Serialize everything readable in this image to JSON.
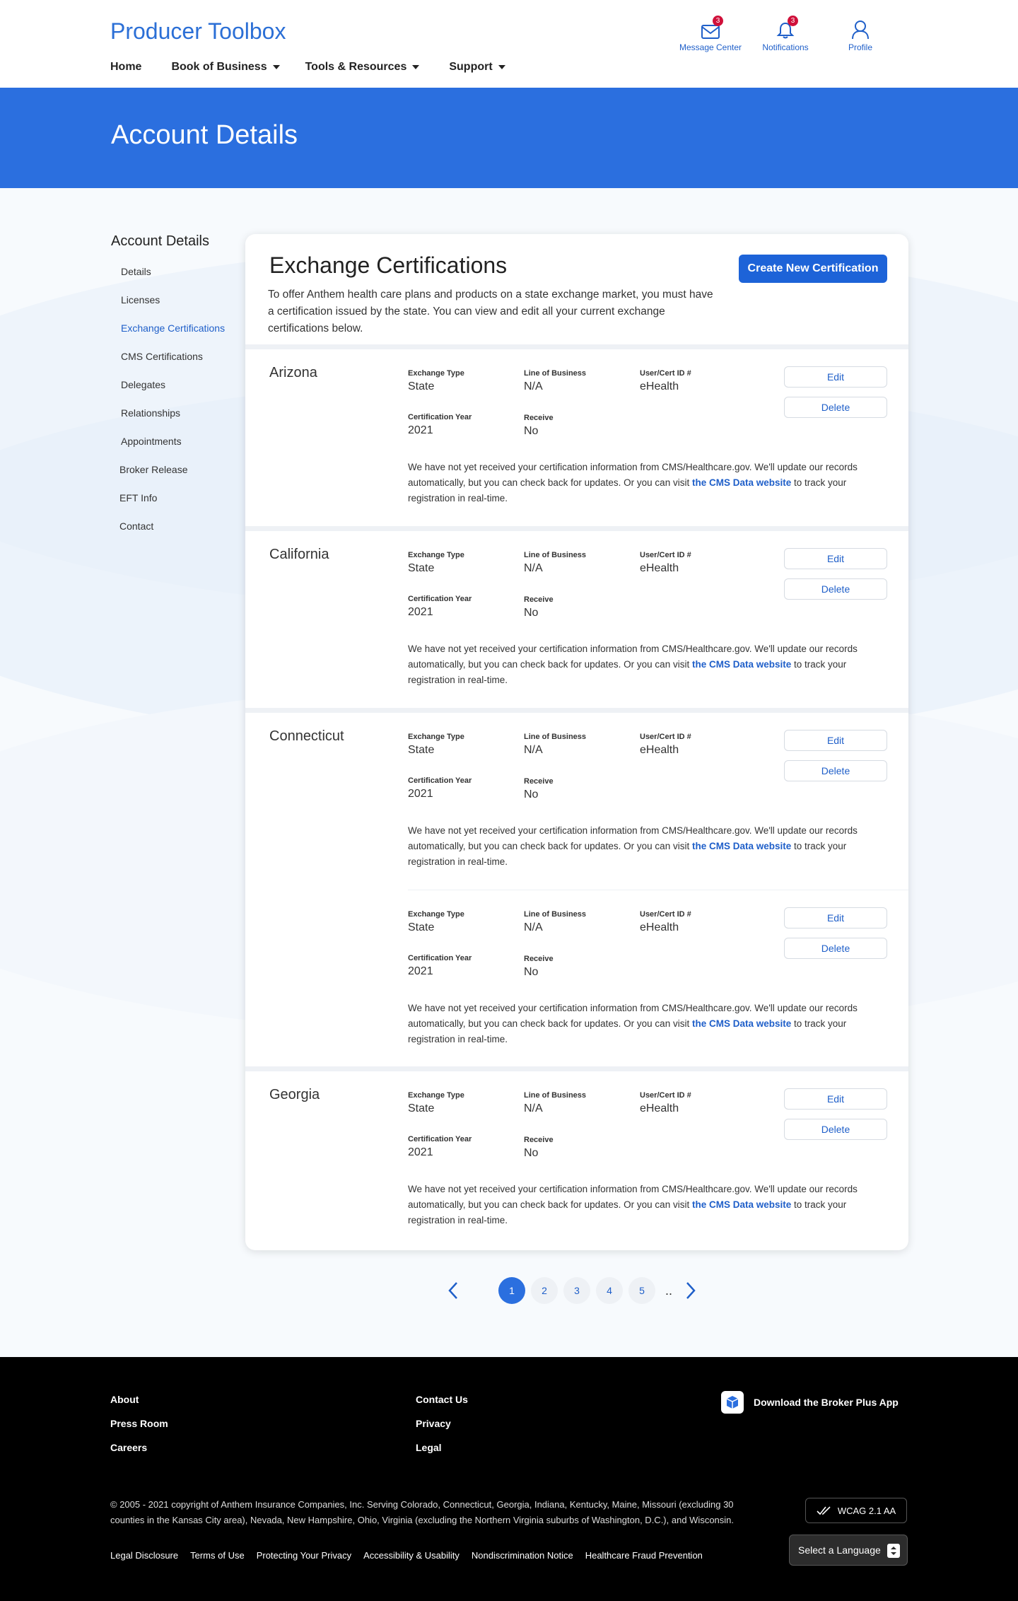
{
  "header": {
    "brand": "Producer Toolbox",
    "icons": {
      "messages": {
        "label": "Message Center",
        "badge": "3"
      },
      "notifications": {
        "label": "Notifications",
        "badge": "3"
      },
      "profile": {
        "label": "Profile"
      }
    },
    "nav": [
      "Home",
      "Book of Business",
      "Tools & Resources",
      "Support"
    ]
  },
  "banner": {
    "title": "Account Details"
  },
  "sidebar": {
    "title": "Account Details",
    "items": [
      "Details",
      "Licenses",
      "Exchange Certifications",
      "CMS Certifications",
      "Delegates",
      "Relationships",
      "Appointments",
      "Broker Release",
      "EFT Info",
      "Contact"
    ],
    "active_item": "Exchange Certifications"
  },
  "card": {
    "title": "Exchange Certifications",
    "description": "To offer Anthem health care plans and products on a state exchange market, you must have a certification issued by the state. You can view and edit all your current exchange certifications below.",
    "create_button": "Create New Certification"
  },
  "labels": {
    "exchange_type": "Exchange Type",
    "line_of_business": "Line of Business",
    "user_cert_id": "User/Cert ID #",
    "certification_year": "Certification Year",
    "receive": "Receive",
    "edit": "Edit",
    "delete": "Delete",
    "msg_before": "We have not yet received your certification information from CMS/Healthcare.gov. We'll update our records automatically, but you can check back for updates. Or you can visit ",
    "msg_link": "the CMS Data website",
    "msg_after": " to track your registration in real-time."
  },
  "states": [
    {
      "name": "Arizona",
      "certs": [
        {
          "exchange_type": "State",
          "line_of_business": "N/A",
          "user_cert_id": "eHealth",
          "certification_year": "2021",
          "receive": "No"
        }
      ]
    },
    {
      "name": "California",
      "certs": [
        {
          "exchange_type": "State",
          "line_of_business": "N/A",
          "user_cert_id": "eHealth",
          "certification_year": "2021",
          "receive": "No"
        }
      ]
    },
    {
      "name": "Connecticut",
      "certs": [
        {
          "exchange_type": "State",
          "line_of_business": "N/A",
          "user_cert_id": "eHealth",
          "certification_year": "2021",
          "receive": "No"
        },
        {
          "exchange_type": "State",
          "line_of_business": "N/A",
          "user_cert_id": "eHealth",
          "certification_year": "2021",
          "receive": "No"
        }
      ]
    },
    {
      "name": "Georgia",
      "certs": [
        {
          "exchange_type": "State",
          "line_of_business": "N/A",
          "user_cert_id": "eHealth",
          "certification_year": "2021",
          "receive": "No"
        }
      ]
    }
  ],
  "pagination": {
    "pages": [
      "1",
      "2",
      "3",
      "4",
      "5"
    ],
    "current": "1",
    "ellipsis": ".."
  },
  "footer": {
    "col1": [
      "About",
      "Press Room",
      "Careers"
    ],
    "col2": [
      "Contact Us",
      "Privacy",
      "Legal"
    ],
    "app": "Download the Broker Plus App",
    "copyright": "© 2005 - 2021 copyright of Anthem Insurance Companies, Inc. Serving Colorado, Connecticut, Georgia, Indiana, Kentucky, Maine, Missouri (excluding 30 counties in the Kansas City area), Nevada, New Hampshire, Ohio, Virginia (excluding the Northern Virginia suburbs of Washington, D.C.), and Wisconsin.",
    "wcag": "WCAG 2.1 AA",
    "legal_links": [
      "Legal Disclosure",
      "Terms of Use",
      "Protecting Your Privacy",
      "Accessibility & Usability",
      "Nondiscrimination Notice",
      "Healthcare Fraud Prevention"
    ],
    "language": "Select a Language"
  },
  "colors": {
    "brand": "#2b6fd6",
    "banner": "#2b6fdf",
    "button": "#1d63d8",
    "badge": "#d0103a",
    "footer": "#000000"
  }
}
